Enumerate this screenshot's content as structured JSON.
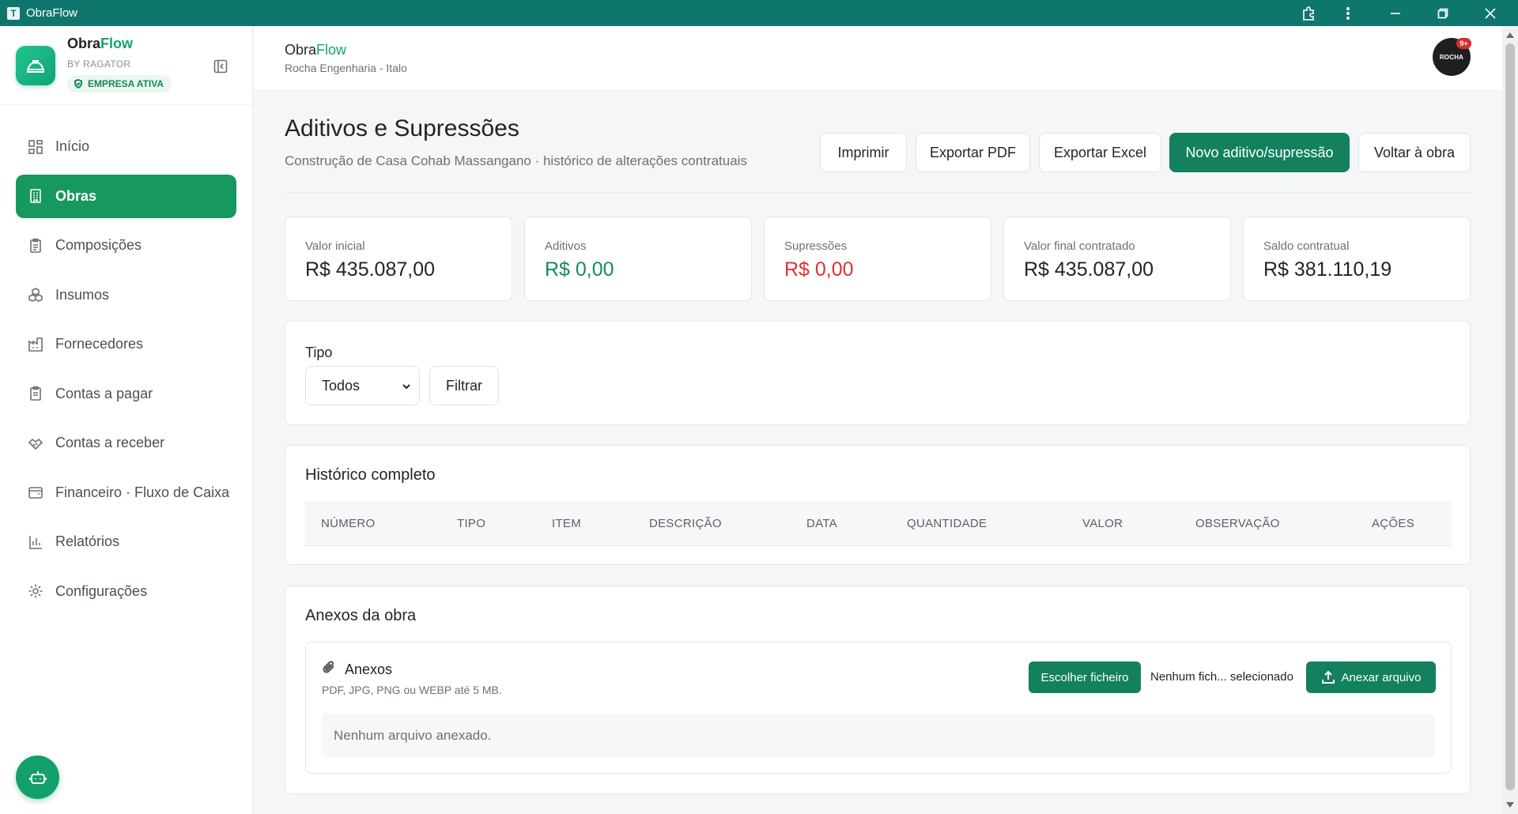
{
  "window": {
    "title": "ObraFlow",
    "logo_letter": "T"
  },
  "brand": {
    "name_part1": "Obra",
    "name_part2": "Flow",
    "by": "BY RAGATOR",
    "badge": "EMPRESA ATIVA"
  },
  "nav": {
    "items": [
      {
        "label": "Início",
        "icon": "grid-icon"
      },
      {
        "label": "Obras",
        "icon": "building-icon",
        "active": true
      },
      {
        "label": "Composições",
        "icon": "clipboard-icon"
      },
      {
        "label": "Insumos",
        "icon": "boxes-icon"
      },
      {
        "label": "Fornecedores",
        "icon": "factory-icon"
      },
      {
        "label": "Contas a pagar",
        "icon": "receipt-icon"
      },
      {
        "label": "Contas a receber",
        "icon": "handshake-icon"
      },
      {
        "label": "Financeiro · Fluxo de Caixa",
        "icon": "wallet-icon"
      },
      {
        "label": "Relatórios",
        "icon": "bar-chart-icon"
      },
      {
        "label": "Configurações",
        "icon": "gear-icon"
      }
    ]
  },
  "header": {
    "title_part1": "Obra",
    "title_part2": "Flow",
    "subtitle": "Rocha Engenharia - Italo",
    "avatar_text": "ROCHA",
    "avatar_badge": "9+"
  },
  "page": {
    "title": "Aditivos e Supressões",
    "subtitle": "Construção de Casa Cohab Massangano · histórico de alterações contratuais"
  },
  "actions": {
    "print": "Imprimir",
    "export_pdf": "Exportar PDF",
    "export_excel": "Exportar Excel",
    "new": "Novo aditivo/supressão",
    "back": "Voltar à obra"
  },
  "kpis": [
    {
      "label": "Valor inicial",
      "value": "R$ 435.087,00",
      "tone": "default"
    },
    {
      "label": "Aditivos",
      "value": "R$ 0,00",
      "tone": "green"
    },
    {
      "label": "Supressões",
      "value": "R$ 0,00",
      "tone": "red"
    },
    {
      "label": "Valor final contratado",
      "value": "R$ 435.087,00",
      "tone": "default"
    },
    {
      "label": "Saldo contratual",
      "value": "R$ 381.110,19",
      "tone": "default"
    }
  ],
  "filter": {
    "label": "Tipo",
    "selected": "Todos",
    "button": "Filtrar"
  },
  "history": {
    "title": "Histórico completo",
    "columns": [
      "NÚMERO",
      "TIPO",
      "ITEM",
      "DESCRIÇÃO",
      "DATA",
      "QUANTIDADE",
      "VALOR",
      "OBSERVAÇÃO",
      "AÇÕES"
    ],
    "rows": []
  },
  "attachments": {
    "section_title": "Anexos da obra",
    "box_title": "Anexos",
    "hint": "PDF, JPG, PNG ou WEBP até 5 MB.",
    "choose_button": "Escolher ficheiro",
    "no_file": "Nenhum fich... selecionado",
    "attach_button": "Anexar arquivo",
    "empty": "Nenhum arquivo anexado."
  },
  "colors": {
    "brand": "#0f766e",
    "primary": "#13805e",
    "active_nav": "#16985f",
    "positive": "#168a5c",
    "negative": "#e03131"
  }
}
